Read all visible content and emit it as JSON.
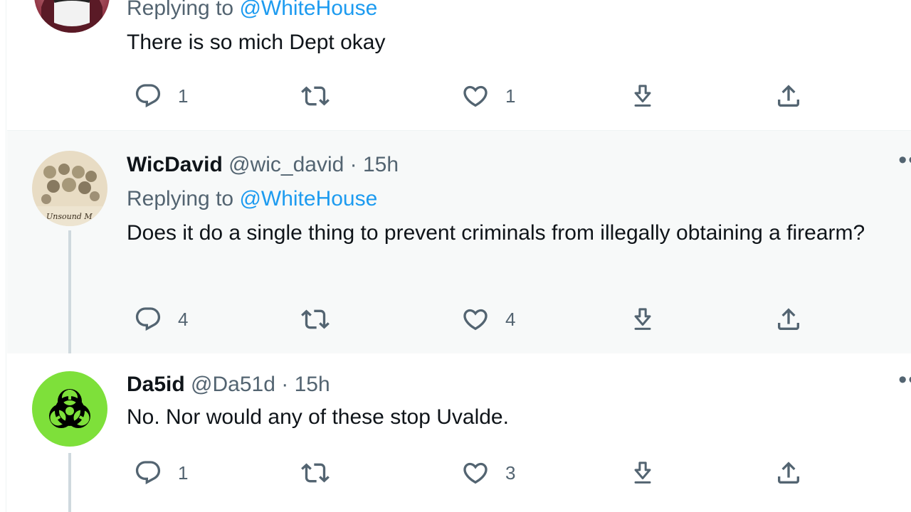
{
  "tweets": [
    {
      "reply_prefix": "Replying to",
      "reply_to": "@WhiteHouse",
      "text": "There is so mich Dept okay",
      "replies": "1",
      "retweets": "",
      "likes": "1"
    },
    {
      "display_name": "WicDavid",
      "handle": "@wic_david",
      "separator": "·",
      "time": "15h",
      "reply_prefix": "Replying to",
      "reply_to": "@WhiteHouse",
      "text": "Does it do a single thing to prevent criminals from illegally obtaining a firearm?",
      "replies": "4",
      "retweets": "",
      "likes": "4",
      "avatar_text": "Unsound M"
    },
    {
      "display_name": "Da5id",
      "handle": "@Da51d",
      "separator": "·",
      "time": "15h",
      "text": "No. Nor would any of these stop Uvalde.",
      "replies": "1",
      "retweets": "",
      "likes": "3"
    }
  ],
  "icons": {
    "reply": "reply-icon",
    "retweet": "retweet-icon",
    "like": "heart-icon",
    "bookmark": "bookmark-icon",
    "share": "share-icon",
    "more": "more-icon"
  },
  "colors": {
    "link": "#1d9bf0",
    "secondary_text": "#536471",
    "highlight_bg": "#f7f9f9",
    "biohazard_green": "#7ee03a"
  }
}
